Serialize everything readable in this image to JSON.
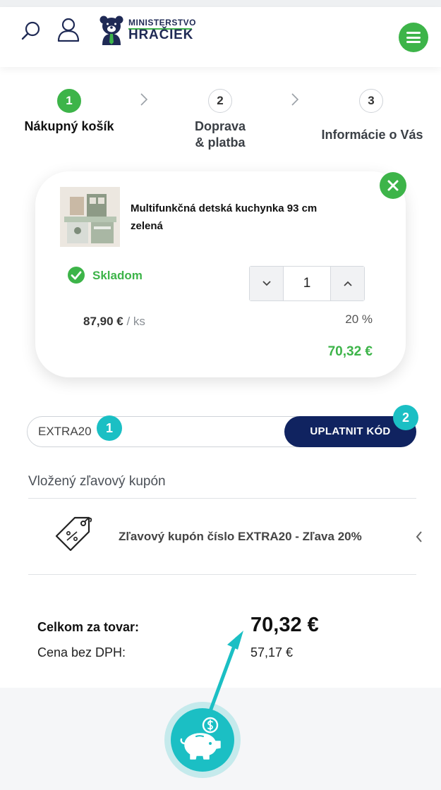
{
  "header": {
    "logo_line1": "MINISTERSTVO",
    "logo_line2": "HRAČIEK",
    "accent_color": "#3db449",
    "brand_color": "#1f2a55"
  },
  "steps": [
    {
      "number": "1",
      "label": "Nákupný košík",
      "active": true
    },
    {
      "number": "2",
      "label_line1": "Doprava",
      "label_line2": "& platba",
      "active": false
    },
    {
      "number": "3",
      "label": "Informácie o Vás",
      "active": false
    }
  ],
  "cart_item": {
    "name_line1": "Multifunkčná detská kuchynka 93 cm",
    "name_line2": "zelená",
    "stock_label": "Skladom",
    "quantity": "1",
    "unit_price": "87,90 €",
    "unit_suffix": "/ ks",
    "discount": "20 %",
    "final_price": "70,32 €"
  },
  "coupon": {
    "input_value": "EXTRA20",
    "apply_label": "UPLATNIT KÓD",
    "marker_1": "1",
    "marker_2": "2",
    "heading": "Vložený zľavový kupón",
    "applied_text": "Zľavový kupón číslo EXTRA20 - Zľava 20%"
  },
  "totals": {
    "total_label": "Celkom za tovar:",
    "total_value": "70,32 €",
    "net_label": "Cena bez DPH:",
    "net_value": "57,17 €"
  },
  "overlay": {
    "marker_color": "#1bbfc4",
    "piggy_icon": "piggy-bank-dollar-icon"
  }
}
